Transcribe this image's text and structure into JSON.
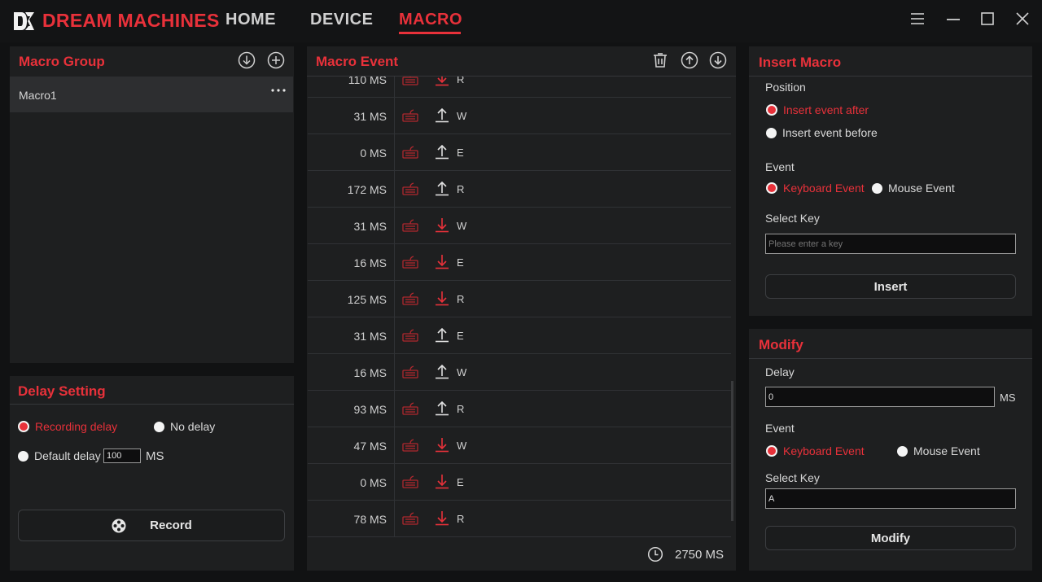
{
  "app": {
    "brand": "DREAM MACHINES",
    "accent_color": "#e8313a",
    "nav": [
      {
        "label": "HOME"
      },
      {
        "label": "DEVICE"
      },
      {
        "label": "MACRO"
      }
    ],
    "active_tab": "MACRO",
    "window_controls": [
      "menu-icon",
      "minimize-icon",
      "maximize-icon",
      "close-icon"
    ]
  },
  "macro_group": {
    "title": "Macro Group",
    "items": [
      {
        "name": "Macro1"
      }
    ]
  },
  "delay_setting": {
    "title": "Delay Setting",
    "options": [
      "Recording delay",
      "No delay",
      "Default delay"
    ],
    "selected": "Recording delay",
    "default_delay_value": "100",
    "unit": "MS",
    "record_label": "Record"
  },
  "macro_event": {
    "title": "Macro Event",
    "rows": [
      {
        "delay": "110 MS",
        "direction": "down",
        "key": "R"
      },
      {
        "delay": "31 MS",
        "direction": "up",
        "key": "W"
      },
      {
        "delay": "0 MS",
        "direction": "up",
        "key": "E"
      },
      {
        "delay": "172 MS",
        "direction": "up",
        "key": "R"
      },
      {
        "delay": "31 MS",
        "direction": "down",
        "key": "W"
      },
      {
        "delay": "16 MS",
        "direction": "down",
        "key": "E"
      },
      {
        "delay": "125 MS",
        "direction": "down",
        "key": "R"
      },
      {
        "delay": "31 MS",
        "direction": "up",
        "key": "E"
      },
      {
        "delay": "16 MS",
        "direction": "up",
        "key": "W"
      },
      {
        "delay": "93 MS",
        "direction": "up",
        "key": "R"
      },
      {
        "delay": "47 MS",
        "direction": "down",
        "key": "W"
      },
      {
        "delay": "0 MS",
        "direction": "down",
        "key": "E"
      },
      {
        "delay": "78 MS",
        "direction": "down",
        "key": "R"
      }
    ],
    "total": "2750 MS"
  },
  "insert_macro": {
    "title": "Insert Macro",
    "position_label": "Position",
    "position_options": [
      "Insert event after",
      "Insert event before"
    ],
    "position_selected": "Insert event after",
    "event_label": "Event",
    "event_options": [
      "Keyboard Event",
      "Mouse Event"
    ],
    "event_selected": "Keyboard Event",
    "select_key_label": "Select Key",
    "select_key_placeholder": "Please enter a key",
    "insert_label": "Insert"
  },
  "modify": {
    "title": "Modify",
    "delay_label": "Delay",
    "delay_value": "0",
    "delay_unit": "MS",
    "event_label": "Event",
    "event_options": [
      "Keyboard Event",
      "Mouse Event"
    ],
    "event_selected": "Keyboard Event",
    "select_key_label": "Select Key",
    "select_key_value": "A",
    "modify_label": "Modify"
  }
}
